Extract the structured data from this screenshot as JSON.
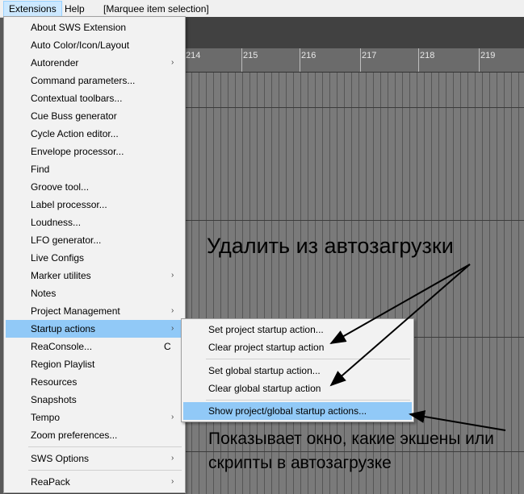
{
  "menubar": {
    "items": [
      {
        "label": "Extensions"
      },
      {
        "label": "Help"
      },
      {
        "label": "[Marquee item selection]"
      }
    ]
  },
  "ruler": {
    "ticks": [
      "214",
      "215",
      "216",
      "217",
      "218",
      "219"
    ]
  },
  "extensions_menu": {
    "items": [
      {
        "label": "About SWS Extension"
      },
      {
        "label": "Auto Color/Icon/Layout"
      },
      {
        "label": "Autorender",
        "submenu": true
      },
      {
        "label": "Command parameters..."
      },
      {
        "label": "Contextual toolbars..."
      },
      {
        "label": "Cue Buss generator"
      },
      {
        "label": "Cycle Action editor..."
      },
      {
        "label": "Envelope processor..."
      },
      {
        "label": "Find"
      },
      {
        "label": "Groove tool..."
      },
      {
        "label": "Label processor..."
      },
      {
        "label": "Loudness..."
      },
      {
        "label": "LFO generator..."
      },
      {
        "label": "Live Configs"
      },
      {
        "label": "Marker utilites",
        "submenu": true
      },
      {
        "label": "Notes"
      },
      {
        "label": "Project Management",
        "submenu": true
      },
      {
        "label": "Startup actions",
        "submenu": true,
        "highlighted": true
      },
      {
        "label": "ReaConsole...",
        "shortcut": "C"
      },
      {
        "label": "Region Playlist"
      },
      {
        "label": "Resources"
      },
      {
        "label": "Snapshots"
      },
      {
        "label": "Tempo",
        "submenu": true
      },
      {
        "label": "Zoom preferences..."
      },
      {
        "label": "SWS Options",
        "submenu": true
      },
      {
        "label": "ReaPack",
        "submenu": true
      }
    ]
  },
  "startup_submenu": {
    "items": [
      {
        "label": "Set project startup action..."
      },
      {
        "label": "Clear project startup action"
      },
      {
        "label": "Set global startup action..."
      },
      {
        "label": "Clear global startup action"
      },
      {
        "label": "Show project/global startup actions...",
        "highlighted": true
      }
    ]
  },
  "annotations": {
    "remove": "Удалить из автозагрузки",
    "show_line1": "Показывает окно, какие экшены или",
    "show_line2": "скрипты в автозагрузке"
  },
  "icons": {
    "submenu_arrow": "chevron-right-icon"
  },
  "colors": {
    "highlight": "#91c9f7",
    "menubar_active": "#cce8ff"
  }
}
